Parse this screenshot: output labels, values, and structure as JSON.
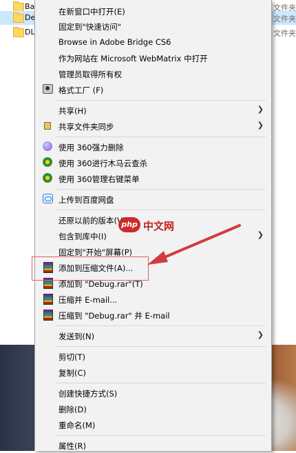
{
  "files": [
    {
      "name": "Ba",
      "type": "文件夹"
    },
    {
      "name": "De",
      "type": "文件夹"
    },
    {
      "name": "DL",
      "type": "文件夹"
    }
  ],
  "menu": {
    "items": [
      {
        "label": "在新窗口中打开(E)"
      },
      {
        "label": "固定到\"快速访问\""
      },
      {
        "label": "Browse in Adobe Bridge CS6"
      },
      {
        "label": "作为网站在 Microsoft WebMatrix 中打开"
      },
      {
        "label": "管理员取得所有权"
      },
      {
        "label": "格式工厂 (F)",
        "icon": "format-factory-icon"
      },
      {
        "label": "共享(H)",
        "submenu": true
      },
      {
        "label": "共享文件夹同步",
        "icon": "folder-sync-icon",
        "submenu": true
      },
      {
        "label": "使用 360强力删除",
        "icon": "360-delete-icon"
      },
      {
        "label": "使用 360进行木马云查杀",
        "icon": "360-scan-icon"
      },
      {
        "label": "使用 360管理右键菜单",
        "icon": "360-manage-icon"
      },
      {
        "label": "上传到百度网盘",
        "icon": "baidu-cloud-icon"
      },
      {
        "label": "还原以前的版本(V)"
      },
      {
        "label": "包含到库中(I)",
        "submenu": true
      },
      {
        "label": "固定到\"开始\"屏幕(P)"
      },
      {
        "label": "添加到压缩文件(A)...",
        "icon": "winrar-icon"
      },
      {
        "label": "添加到 \"Debug.rar\"(T)",
        "icon": "winrar-icon"
      },
      {
        "label": "压缩并 E-mail...",
        "icon": "winrar-icon"
      },
      {
        "label": "压缩到 \"Debug.rar\" 并 E-mail",
        "icon": "winrar-icon"
      },
      {
        "label": "发送到(N)",
        "submenu": true
      },
      {
        "label": "剪切(T)"
      },
      {
        "label": "复制(C)"
      },
      {
        "label": "创建快捷方式(S)"
      },
      {
        "label": "删除(D)"
      },
      {
        "label": "重命名(M)"
      },
      {
        "label": "属性(R)"
      }
    ],
    "submenu_arrow": "❯"
  },
  "watermark": {
    "logo": "php",
    "text": "中文网"
  },
  "colors": {
    "highlight": "#e06060",
    "arrow": "#d23c3c",
    "selection": "#cce8ff"
  }
}
